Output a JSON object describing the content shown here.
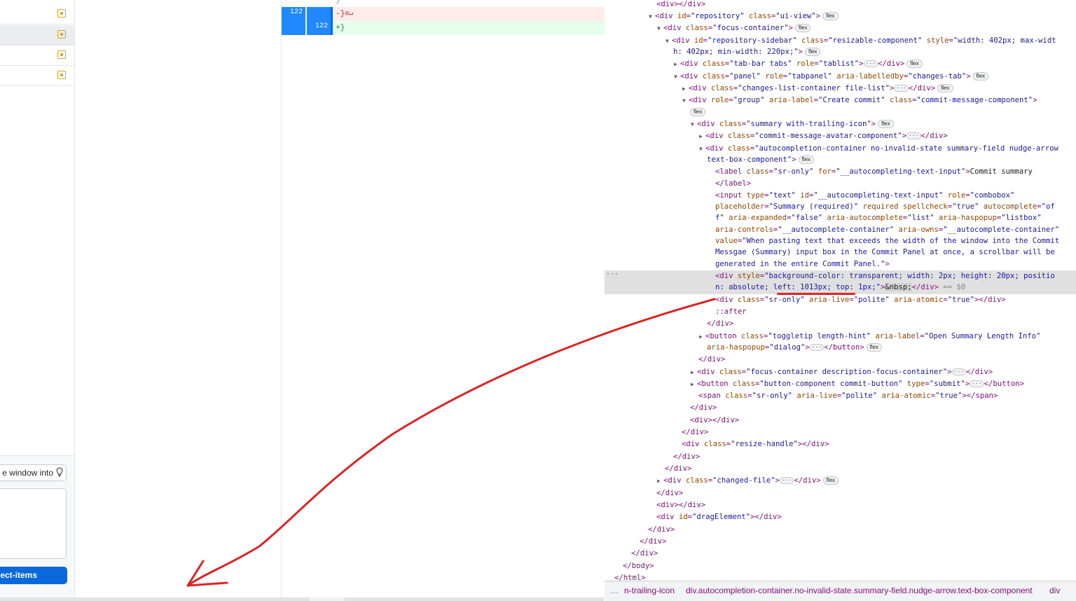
{
  "left_pane": {
    "file_rows": 4,
    "commit_panel": {
      "summary_visible_text": "e window into",
      "commit_button_text": "ect-items"
    }
  },
  "diff": {
    "lines": [
      {
        "type": "del",
        "old": "122",
        "new": "",
        "code": "-}"
      },
      {
        "type": "add",
        "old": "",
        "new": "122",
        "code": "+}"
      }
    ]
  },
  "devtools": {
    "dom_lines": [
      "<div></div>",
      "repository-line",
      "focus-container-line",
      "sidebar-line"
    ],
    "breadcrumbs": [
      "…",
      "n-trailing-icon",
      "div.autocompletion-container.no-invalid-state.summary-field.nudge-arrow.text-box-component",
      "div"
    ]
  },
  "colors": {
    "accent": "#0969da",
    "annotation": "#d92525",
    "modified": "#d4a72c"
  }
}
